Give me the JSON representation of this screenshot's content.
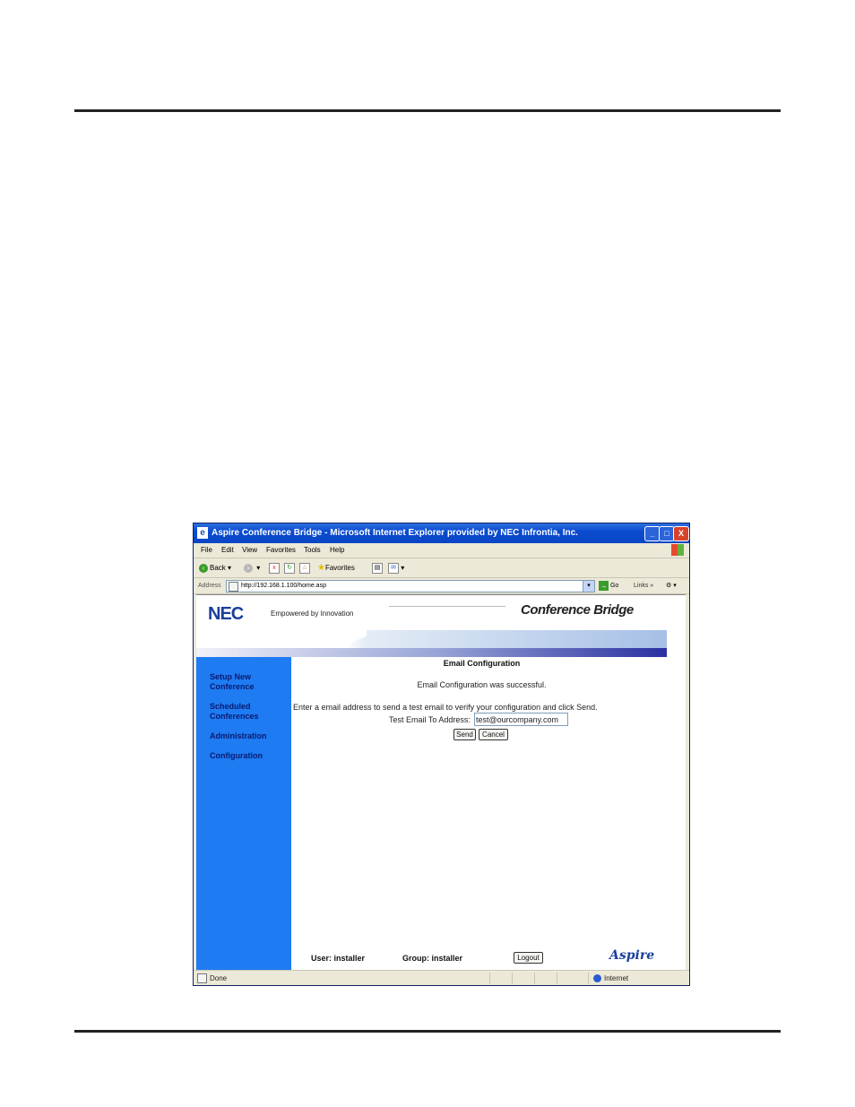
{
  "window": {
    "title": "Aspire Conference Bridge - Microsoft Internet Explorer provided by NEC Infrontia, Inc.",
    "controls": [
      "_",
      "□",
      "X"
    ]
  },
  "menu": [
    "File",
    "Edit",
    "View",
    "Favorites",
    "Tools",
    "Help"
  ],
  "toolbar": {
    "back": "Back",
    "favorites": "Favorites"
  },
  "address": {
    "label": "Address",
    "url": "http://192.168.1.100/home.asp",
    "go": "Go",
    "links": "Links",
    "chevrons": "»"
  },
  "header": {
    "logo": "NEC",
    "tagline": "Empowered by Innovation",
    "product": "Conference Bridge"
  },
  "sidebar": {
    "items": [
      {
        "label": "Setup New Conference"
      },
      {
        "label": "Scheduled Conferences"
      },
      {
        "label": "Administration"
      },
      {
        "label": "Configuration"
      }
    ]
  },
  "main": {
    "title": "Email Configuration",
    "success": "Email Configuration was successful.",
    "instructions": "Enter a email address to send a test email to verify your configuration and click Send.",
    "email_label": "Test Email To Address:",
    "email_value": "test@ourcompany.com",
    "send": "Send",
    "cancel": "Cancel"
  },
  "footer": {
    "user": "User: installer",
    "group": "Group: installer",
    "logout": "Logout",
    "brand": "Aspire"
  },
  "status": {
    "text": "Done",
    "zone": "Internet"
  }
}
